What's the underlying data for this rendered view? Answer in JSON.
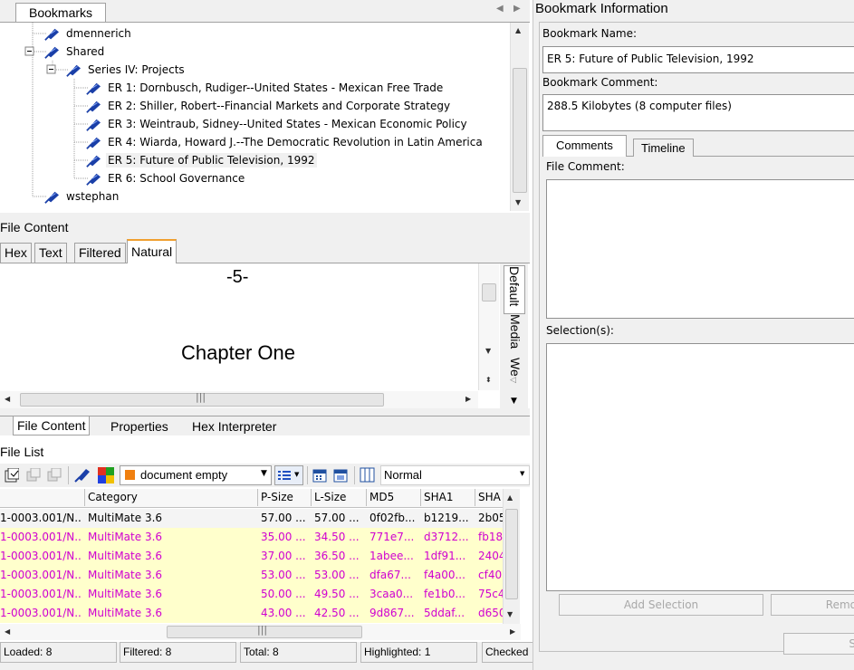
{
  "bookmarks_panel": {
    "tab_label": "Bookmarks",
    "tree": [
      {
        "label": "dmennerich",
        "level": 1,
        "selected": false
      },
      {
        "label": "Shared",
        "level": 1,
        "selected": false
      },
      {
        "label": "Series IV: Projects",
        "level": 2,
        "selected": false
      },
      {
        "label": "ER 1: Dornbusch, Rudiger--United States - Mexican Free Trade",
        "level": 3,
        "selected": false
      },
      {
        "label": "ER 2: Shiller, Robert--Financial Markets and Corporate Strategy",
        "level": 3,
        "selected": false
      },
      {
        "label": "ER 3: Weintraub, Sidney--United States - Mexican Economic Policy",
        "level": 3,
        "selected": false
      },
      {
        "label": "ER 4: Wiarda, Howard J.--The Democratic Revolution in Latin America",
        "level": 3,
        "selected": false
      },
      {
        "label": "ER 5: Future of Public Television, 1992",
        "level": 3,
        "selected": true
      },
      {
        "label": "ER 6: School Governance",
        "level": 3,
        "selected": false
      },
      {
        "label": "wstephan",
        "level": 1,
        "selected": false
      }
    ]
  },
  "file_content": {
    "title": "File Content",
    "tabs": [
      "Hex",
      "Text",
      "Filtered",
      "Natural"
    ],
    "active_tab": "Natural",
    "page_number": "-5-",
    "heading": "Chapter One",
    "side_tabs": [
      "Default",
      "Media",
      "We"
    ],
    "bottom_tabs": [
      "File Content",
      "Properties",
      "Hex Interpreter"
    ]
  },
  "file_list": {
    "title": "File List",
    "filter_value": "document empty",
    "view_value": "Normal",
    "columns": [
      "Category",
      "P-Size",
      "L-Size",
      "MD5",
      "SHA1",
      "SHA"
    ],
    "rows": [
      {
        "name": "1-0003.001/N...",
        "category": "MultiMate 3.6",
        "psize": "57.00 ...",
        "lsize": "57.00 ...",
        "md5": "0f02fb...",
        "sha1": "b1219...",
        "sha": "2b05",
        "style": "first"
      },
      {
        "name": "1-0003.001/N...",
        "category": "MultiMate 3.6",
        "psize": "35.00 ...",
        "lsize": "34.50 ...",
        "md5": "771e7...",
        "sha1": "d3712...",
        "sha": "fb18",
        "style": "hl"
      },
      {
        "name": "1-0003.001/N...",
        "category": "MultiMate 3.6",
        "psize": "37.00 ...",
        "lsize": "36.50 ...",
        "md5": "1abee...",
        "sha1": "1df91...",
        "sha": "2404",
        "style": "hl"
      },
      {
        "name": "1-0003.001/N...",
        "category": "MultiMate 3.6",
        "psize": "53.00 ...",
        "lsize": "53.00 ...",
        "md5": "dfa67...",
        "sha1": "f4a00...",
        "sha": "cf40",
        "style": "hl"
      },
      {
        "name": "1-0003.001/N...",
        "category": "MultiMate 3.6",
        "psize": "50.00 ...",
        "lsize": "49.50 ...",
        "md5": "3caa0...",
        "sha1": "fe1b0...",
        "sha": "75c4",
        "style": "hl"
      },
      {
        "name": "1-0003.001/N...",
        "category": "MultiMate 3.6",
        "psize": "43.00 ...",
        "lsize": "42.50 ...",
        "md5": "9d867...",
        "sha1": "5ddaf...",
        "sha": "d650",
        "style": "hl"
      }
    ]
  },
  "status_bar": {
    "loaded": "Loaded: 8",
    "filtered": "Filtered: 8",
    "total": "Total: 8",
    "highlighted": "Highlighted: 1",
    "checked": "Checked"
  },
  "bookmark_info": {
    "title": "Bookmark Information",
    "name_label": "Bookmark Name:",
    "name_value": "ER 5: Future of Public Television, 1992",
    "comment_label": "Bookmark Comment:",
    "comment_value": "288.5 Kilobytes (8 computer files)",
    "tabs": [
      "Comments",
      "Timeline"
    ],
    "active_tab": "Comments",
    "file_comment_label": "File Comment:",
    "selections_label": "Selection(s):",
    "add_selection_label": "Add Selection",
    "remove_label": "Remo",
    "bottom_button_label": "S"
  },
  "colors": {
    "highlight_row_bg": "#ffffcc",
    "highlight_row_text": "#d000d0",
    "active_tab_border": "#f0a030",
    "pin_blue": "#1a3fa8"
  }
}
